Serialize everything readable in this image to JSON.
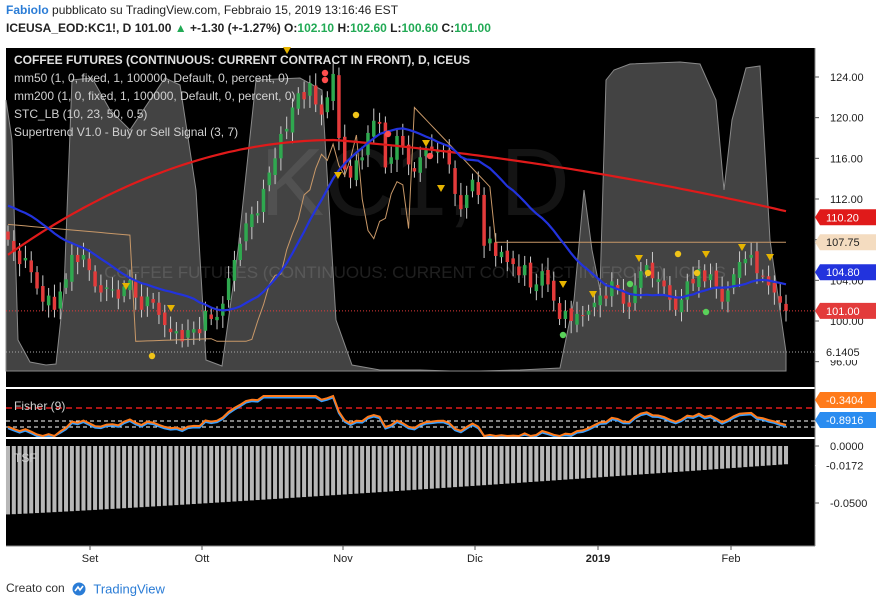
{
  "header": {
    "author": "Fabiolo",
    "published": "pubblicato su TradingView.com, Febbraio 15, 2019 13:16:46 EST",
    "symbol": "ICEUSA_EOD:KC1!, D",
    "last": "101.00",
    "change": "+-1.30 (+-1.27%)",
    "open_label": "O:",
    "open": "102.10",
    "high_label": "H:",
    "high": "102.60",
    "low_label": "L:",
    "low": "100.60",
    "close_label": "C:",
    "close": "101.00"
  },
  "legend": {
    "title": "COFFEE FUTURES (CONTINUOUS: CURRENT CONTRACT IN FRONT), D, ICEUS",
    "mm50": "mm50 (1, 0, fixed, 1, 100000, Default, 0, percent, 0)",
    "mm200": "mm200 (1, 0, fixed, 1, 100000, Default, 0, percent, 0)",
    "stc": "STC_LB (10, 23, 50, 0.5)",
    "supertrend": "Supertrend V1.0 - Buy or Sell Signal (3, 7)"
  },
  "watermark": {
    "big": "KC1, D",
    "line": "COFFEE FUTURES (CONTINUOUS: CURRENT CONTRACT IN FRONT), ICEUS"
  },
  "fisher": {
    "label": "Fisher (9)",
    "val1": "-0.3404",
    "val2": "-0.8916"
  },
  "tsf": {
    "label": "TSF",
    "val": "-0.0172",
    "ticks": [
      "0.0000",
      "-0.0500"
    ]
  },
  "price_axis": {
    "ticks": [
      "124.00",
      "120.00",
      "116.00",
      "112.00",
      "108.00",
      "104.00",
      "100.00",
      "96.00"
    ],
    "badges": {
      "mm200": "110.20",
      "supertrend": "107.75",
      "mm50": "104.80",
      "last": "101.00",
      "stc": "6.1405"
    }
  },
  "time_axis": [
    "Set",
    "Ott",
    "Nov",
    "Dic",
    "2019",
    "Feb"
  ],
  "footer": {
    "created": "Creato con",
    "brand": "TradingView"
  },
  "colors": {
    "up": "#2fa84f",
    "down": "#e33b3b",
    "ma200": "#e01a1a",
    "ma50": "#2233dd",
    "stc_fill": "#5a5a5a",
    "fisher_a": "#ff7a1a",
    "fisher_b": "#3aa0ff"
  },
  "chart_data": {
    "type": "candlestick",
    "series": [
      {
        "name": "KC1!",
        "close": [
          108.0,
          106.8,
          105.6,
          106.2,
          104.8,
          103.2,
          101.9,
          102.5,
          101.1,
          102.9,
          104.1,
          106.5,
          105.8,
          106.5,
          105.0,
          103.4,
          102.8,
          103.3,
          103.1,
          102.2,
          103.4,
          104.0,
          102.3,
          101.1,
          102.4,
          101.8,
          100.6,
          99.6,
          98.9,
          99.0,
          98.0,
          99.1,
          99.2,
          98.8,
          101.0,
          100.2,
          100.4,
          101.7,
          104.2,
          106.0,
          107.6,
          109.6,
          110.5,
          110.6,
          113.0,
          114.6,
          116.0,
          118.4,
          118.9,
          121.0,
          122.4,
          121.8,
          123.4,
          121.3,
          120.3,
          122.0,
          124.3,
          118.0,
          114.9,
          114.1,
          115.8,
          116.1,
          118.5,
          119.7,
          119.4,
          115.1,
          116.1,
          118.2,
          117.1,
          115.4,
          114.7,
          116.1,
          116.8,
          116.8,
          116.8,
          116.6,
          115.4,
          112.5,
          111.0,
          112.4,
          113.9,
          112.4,
          107.4,
          108.1,
          106.4,
          106.8,
          105.8,
          105.6,
          104.5,
          105.5,
          103.3,
          103.6,
          104.9,
          103.6,
          102.0,
          100.2,
          101.0,
          100.0,
          100.7,
          100.5,
          101.0,
          101.8,
          102.5,
          102.2,
          103.9,
          103.2,
          101.7,
          101.4,
          103.5,
          104.9,
          105.5,
          104.2,
          104.1,
          103.4,
          102.1,
          101.1,
          102.1,
          103.9,
          103.7,
          105.1,
          103.9,
          104.6,
          103.4,
          101.9,
          103.0,
          104.6,
          105.8,
          106.1,
          106.5,
          104.7,
          104.4,
          103.5,
          102.8,
          101.8,
          101.0
        ]
      }
    ],
    "indicators": {
      "mm50_last": 104.8,
      "mm200_last": 110.2,
      "supertrend_last": 107.75,
      "stc_last": 6.1405,
      "fisher_last": [
        -0.3404,
        -0.8916
      ],
      "tsf_last": -0.0172
    },
    "ylim": [
      95,
      126
    ],
    "xlabel": "",
    "ylabel": ""
  }
}
